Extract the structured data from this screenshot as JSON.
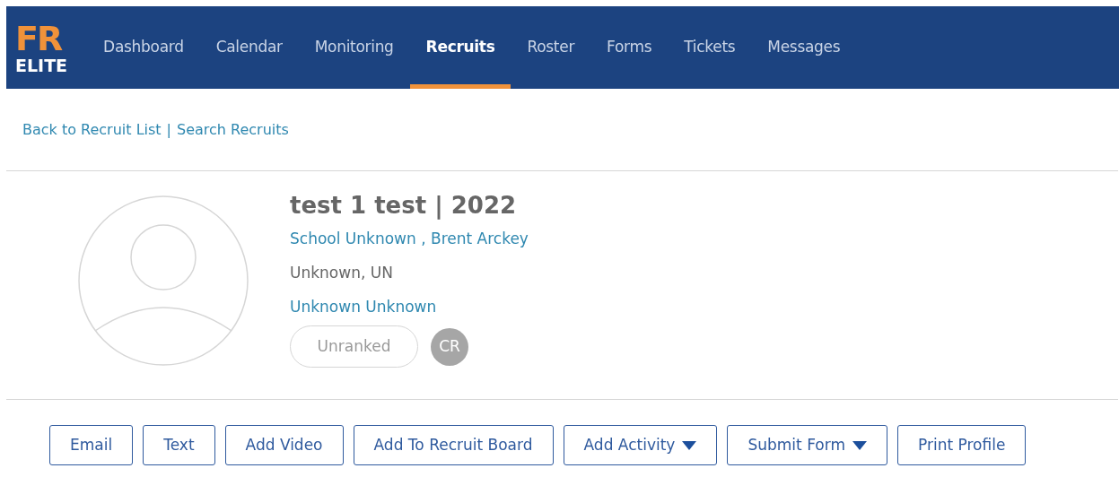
{
  "logo": {
    "top": "FR",
    "bottom": "ELITE"
  },
  "nav": [
    {
      "label": "Dashboard",
      "selected": false
    },
    {
      "label": "Calendar",
      "selected": false
    },
    {
      "label": "Monitoring",
      "selected": false
    },
    {
      "label": "Recruits",
      "selected": true
    },
    {
      "label": "Roster",
      "selected": false
    },
    {
      "label": "Forms",
      "selected": false
    },
    {
      "label": "Tickets",
      "selected": false
    },
    {
      "label": "Messages",
      "selected": false
    }
  ],
  "breadcrumb": {
    "links": [
      "Back to Recruit List",
      "Search Recruits"
    ],
    "separator": "|"
  },
  "profile": {
    "name": "test 1 test | 2022",
    "school": "School Unknown , Brent Arckey",
    "location": "Unknown, UN",
    "position": "Unknown Unknown",
    "rank": "Unranked",
    "initials": "CR"
  },
  "actions": [
    {
      "label": "Email",
      "kind": "plain"
    },
    {
      "label": "Text",
      "kind": "plain"
    },
    {
      "label": "Add Video",
      "kind": "plain"
    },
    {
      "label": "Add To Recruit Board",
      "kind": "plain"
    },
    {
      "label": "Add Activity",
      "kind": "dropdown"
    },
    {
      "label": "Submit Form",
      "kind": "dropdown"
    },
    {
      "label": "Print Profile",
      "kind": "plain"
    }
  ]
}
